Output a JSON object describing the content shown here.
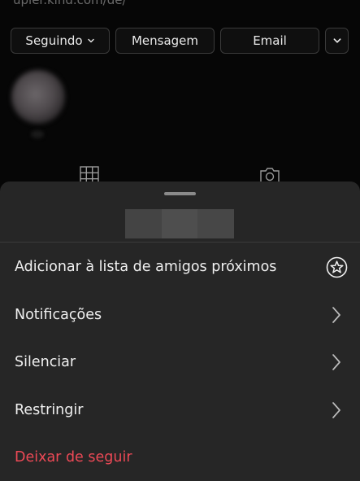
{
  "profile": {
    "url_fragment": "upler.kind.com/de/",
    "buttons": {
      "following_label": "Seguindo",
      "message_label": "Mensagem",
      "email_label": "Email"
    },
    "icons": {
      "following_chevron": "chevron-down-icon",
      "more_chevron": "chevron-down-icon",
      "grid_tab": "grid-icon",
      "tagged_tab": "camera-icon"
    }
  },
  "sheet": {
    "username_redacted": true,
    "menu": [
      {
        "label": "Adicionar à lista de amigos próximos",
        "icon": "star-circle-icon"
      },
      {
        "label": "Notificações",
        "icon": "chevron-right-icon"
      },
      {
        "label": "Silenciar",
        "icon": "chevron-right-icon"
      },
      {
        "label": "Restringir",
        "icon": "chevron-right-icon"
      },
      {
        "label": "Deixar de seguir",
        "icon": null
      }
    ]
  },
  "colors": {
    "background": "#060606",
    "sheet": "#262626",
    "danger": "#ed4956",
    "text": "#f0f0f0"
  }
}
